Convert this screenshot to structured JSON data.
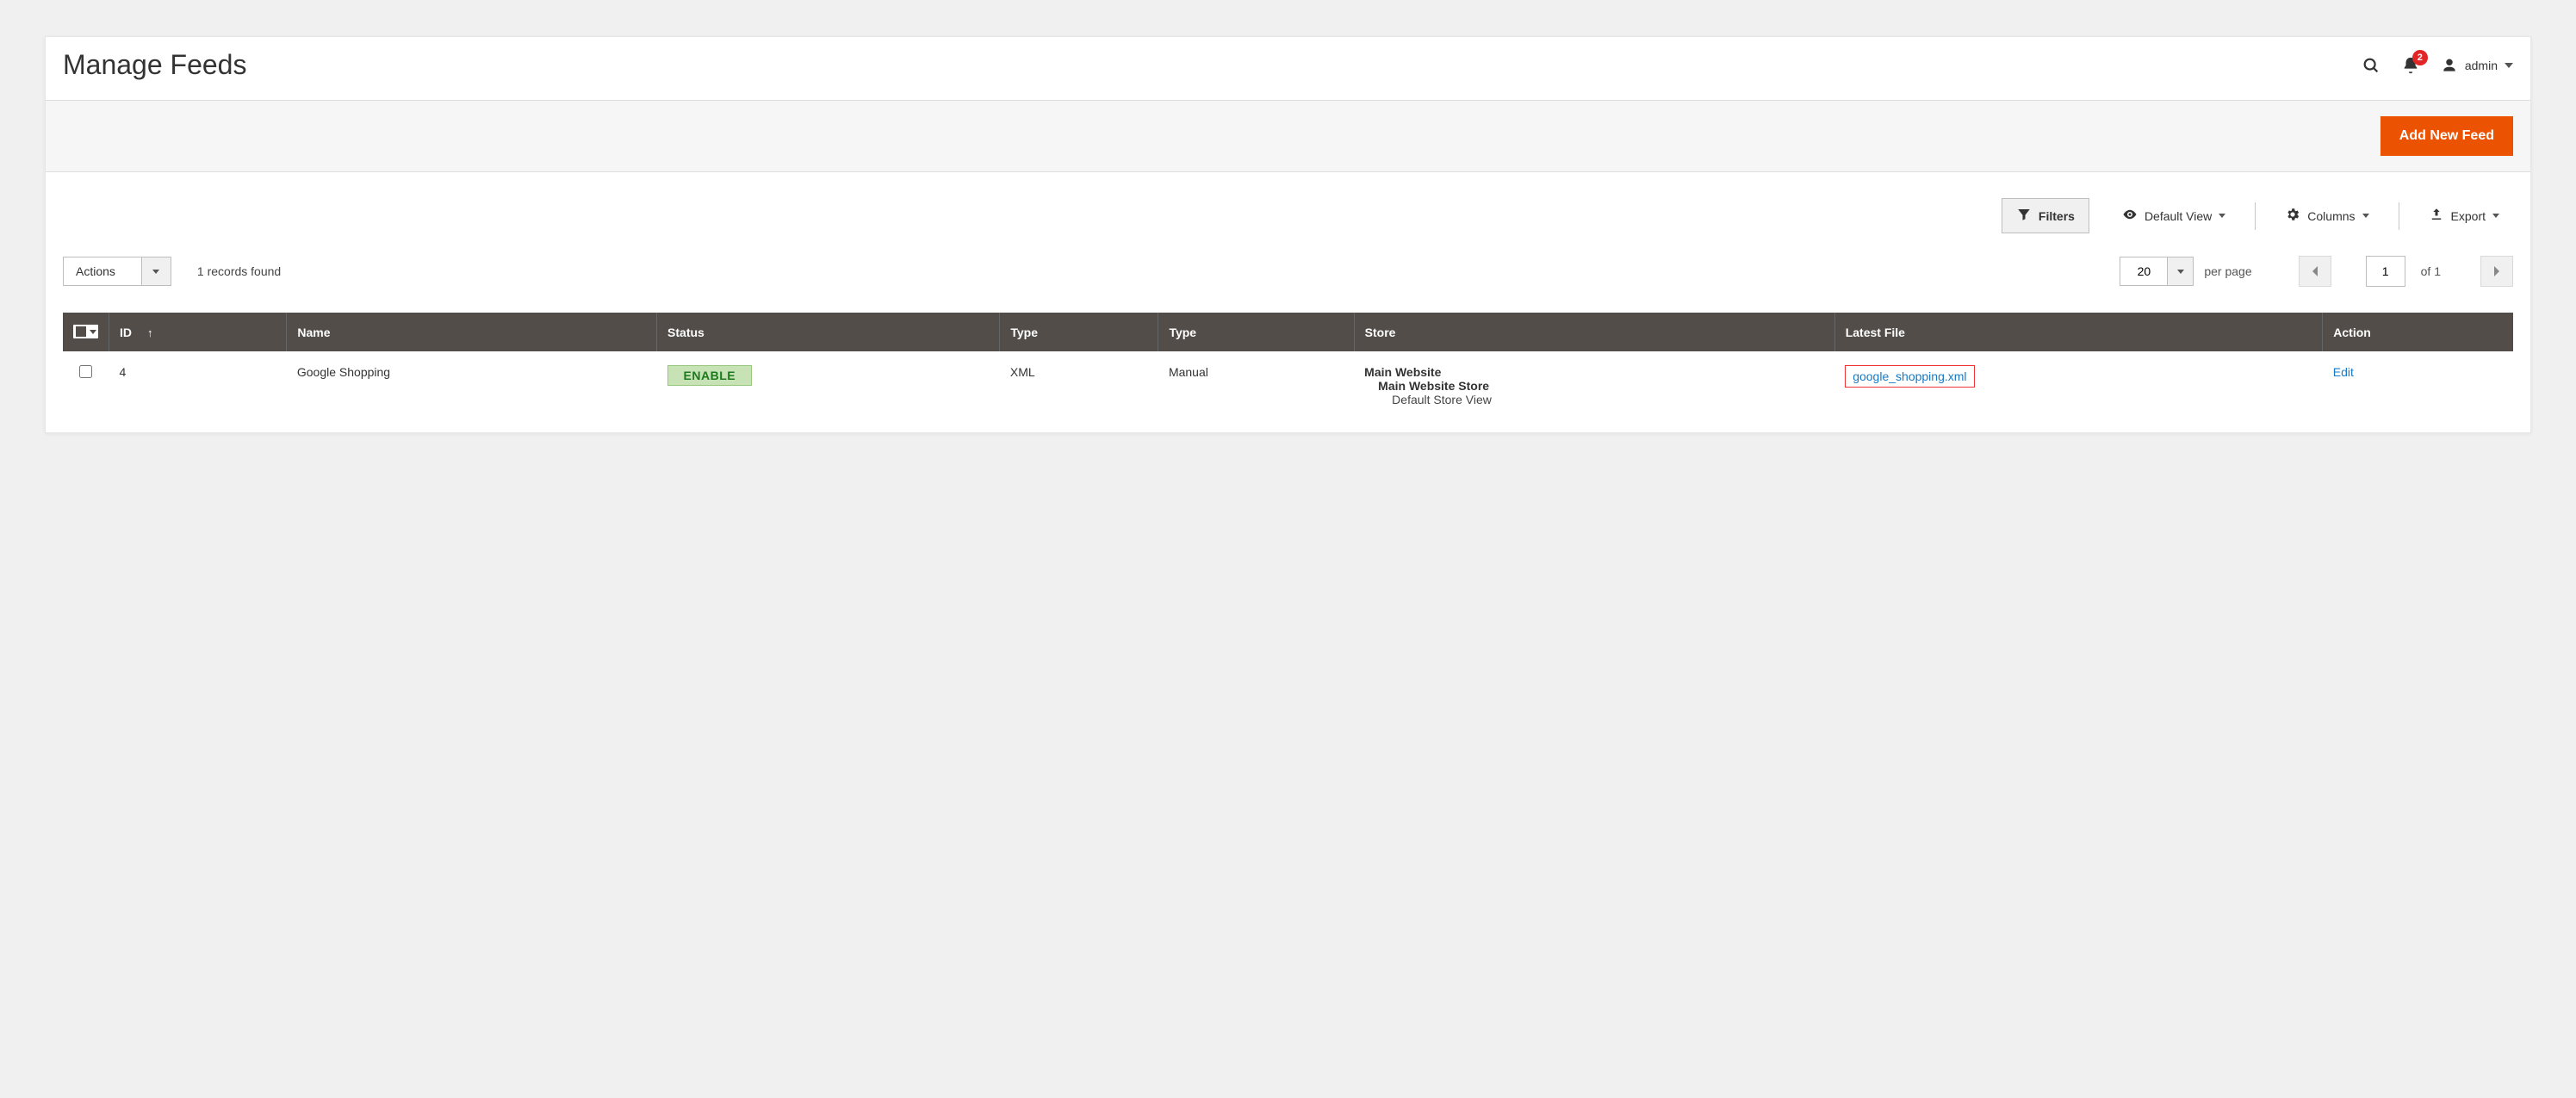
{
  "header": {
    "title": "Manage Feeds",
    "notification_count": "2",
    "username": "admin"
  },
  "toolbar": {
    "add_button": "Add New Feed"
  },
  "controls": {
    "filters": "Filters",
    "default_view": "Default View",
    "columns": "Columns",
    "export": "Export"
  },
  "actions": {
    "label": "Actions",
    "records_found": "1 records found",
    "per_page_value": "20",
    "per_page_label": "per page",
    "current_page": "1",
    "of_label": "of 1"
  },
  "table": {
    "headers": {
      "id": "ID",
      "name": "Name",
      "status": "Status",
      "type1": "Type",
      "type2": "Type",
      "store": "Store",
      "latest_file": "Latest File",
      "action": "Action"
    },
    "rows": [
      {
        "id": "4",
        "name": "Google Shopping",
        "status": "ENABLE",
        "type1": "XML",
        "type2": "Manual",
        "store_l1": "Main Website",
        "store_l2": "Main Website Store",
        "store_l3": "Default Store View",
        "latest_file": "google_shopping.xml",
        "action": "Edit"
      }
    ]
  }
}
